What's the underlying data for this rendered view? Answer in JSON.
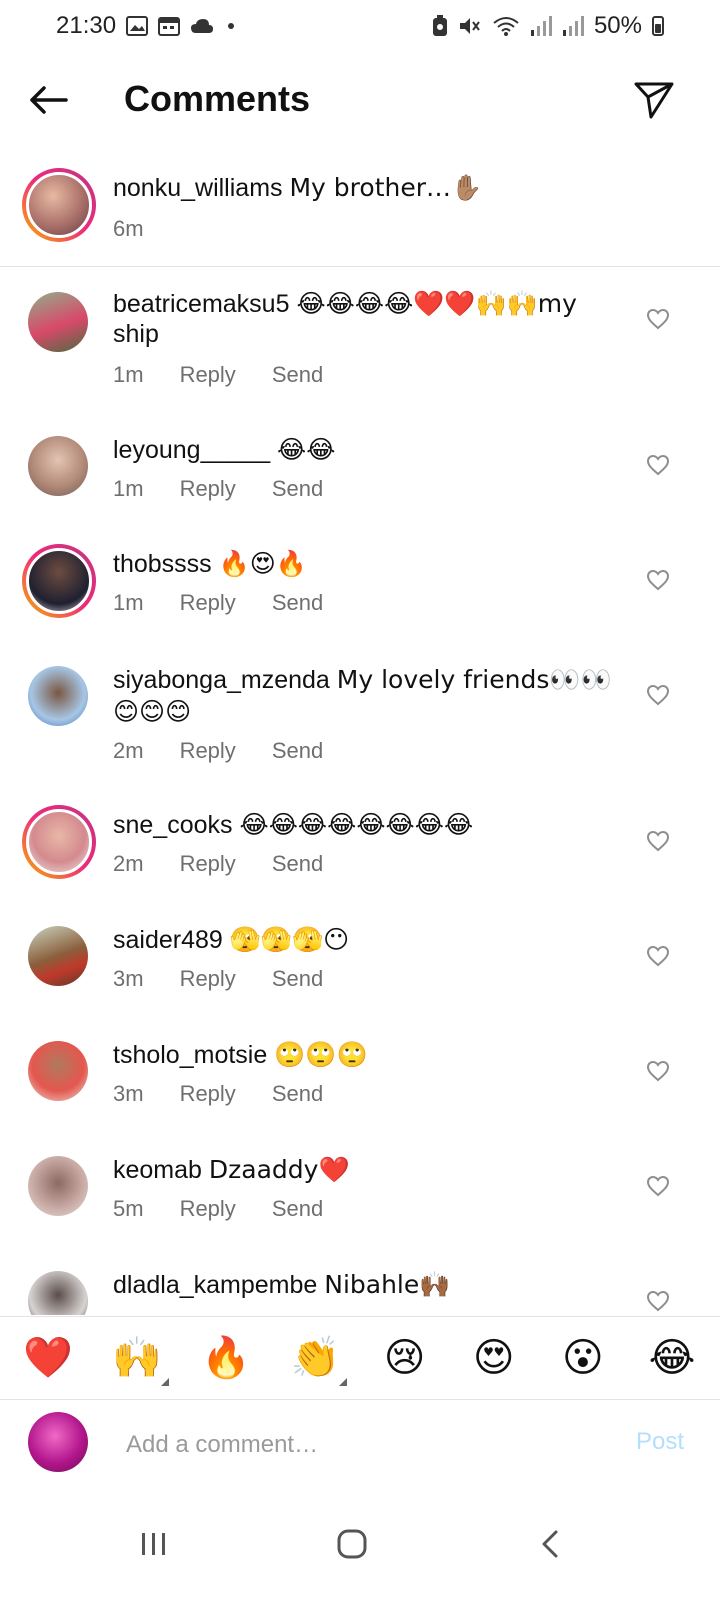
{
  "status_bar": {
    "time": "21:30",
    "battery_percent": "50%"
  },
  "header": {
    "title": "Comments"
  },
  "caption": {
    "username": "nonku_williams",
    "text": "My brother…✋🏽",
    "time": "6m"
  },
  "comments": [
    {
      "username": "beatricemaksu5",
      "text": "😂😂😂😂❤️❤️🙌🙌my",
      "text2": "ship",
      "time": "1m",
      "reply": "Reply",
      "send": "Send",
      "avatar_color": "#6e8a5a"
    },
    {
      "username": "leyoung_____",
      "text": "😂😂",
      "time": "1m",
      "reply": "Reply",
      "send": "Send",
      "avatar_color": "#b98d7a"
    },
    {
      "username": "thobssss",
      "text": "🔥😍🔥",
      "time": "1m",
      "reply": "Reply",
      "send": "Send",
      "avatar_color": "#2b2b3a"
    },
    {
      "username": "siyabonga_mzenda",
      "text": "My lovely friends👀👀",
      "text2": "😊😊😊",
      "time": "2m",
      "reply": "Reply",
      "send": "Send",
      "avatar_color": "#6a9bc3"
    },
    {
      "username": "sne_cooks",
      "text": "😂😂😂😂😂😂😂😂",
      "time": "2m",
      "reply": "Reply",
      "send": "Send",
      "avatar_color": "#d9a38f"
    },
    {
      "username": "saider489",
      "text": "🫣🫣🫣😶",
      "time": "3m",
      "reply": "Reply",
      "send": "Send",
      "avatar_color": "#8b6a4e"
    },
    {
      "username": "tsholo_motsie",
      "text": "🙄🙄🙄",
      "time": "3m",
      "reply": "Reply",
      "send": "Send",
      "avatar_color": "#d9796e"
    },
    {
      "username": "keomab",
      "text": "Dzaaddy❤️",
      "time": "5m",
      "reply": "Reply",
      "send": "Send",
      "avatar_color": "#a07f78"
    },
    {
      "username": "dladla_kampembe",
      "text": "Nibahle🙌🏾",
      "time": "",
      "reply": "",
      "send": "",
      "avatar_color": "#5b4d49"
    }
  ],
  "quick_emojis": [
    "❤️",
    "🙌",
    "🔥",
    "👏",
    "😢",
    "😍",
    "😮",
    "😂"
  ],
  "comment_box": {
    "placeholder": "Add a comment…",
    "post_label": "Post"
  },
  "colors": {
    "story_ring_start": "#f8b400",
    "story_ring_end": "#c13584",
    "muted_text": "#6f6f6f",
    "post_disabled": "#b2dffc"
  }
}
